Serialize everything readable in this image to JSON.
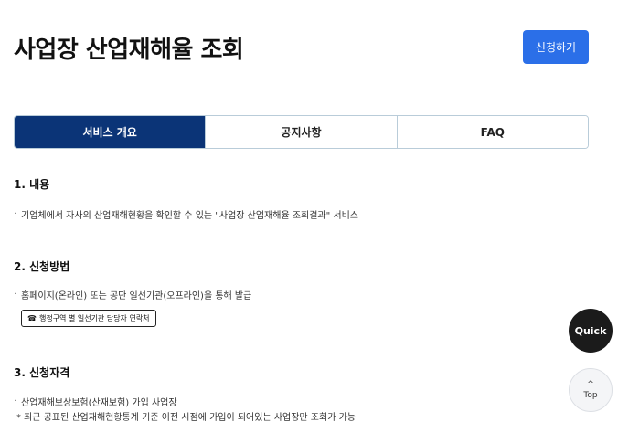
{
  "header": {
    "title": "사업장 산업재해율 조회",
    "apply_label": "신청하기"
  },
  "tabs": [
    {
      "label": "서비스 개요",
      "active": true
    },
    {
      "label": "공지사항",
      "active": false
    },
    {
      "label": "FAQ",
      "active": false
    }
  ],
  "sections": {
    "content": {
      "title": "1. 내용",
      "items": [
        "기업체에서 자사의 산업재해현황을 확인할 수 있는 \"사업장 산업재해율 조회결과\" 서비스"
      ]
    },
    "method": {
      "title": "2. 신청방법",
      "items": [
        "홈페이지(온라인) 또는 공단 일선기관(오프라인)을 통해 발급"
      ],
      "contact_label": "행정구역 별 일선기관 담당자 연락처"
    },
    "eligibility": {
      "title": "3. 신청자격",
      "items": [
        "산업재해보상보험(산재보험) 가입 사업장"
      ],
      "note": "최근 공표된 산업재해현황통계 기준 이전 시점에 가입이 되어있는 사업장만 조회가 가능"
    }
  },
  "floating": {
    "quick_label": "Quick",
    "top_label": "Top"
  },
  "colors": {
    "primary_button": "#2b6fe8",
    "active_tab": "#0b3477"
  }
}
